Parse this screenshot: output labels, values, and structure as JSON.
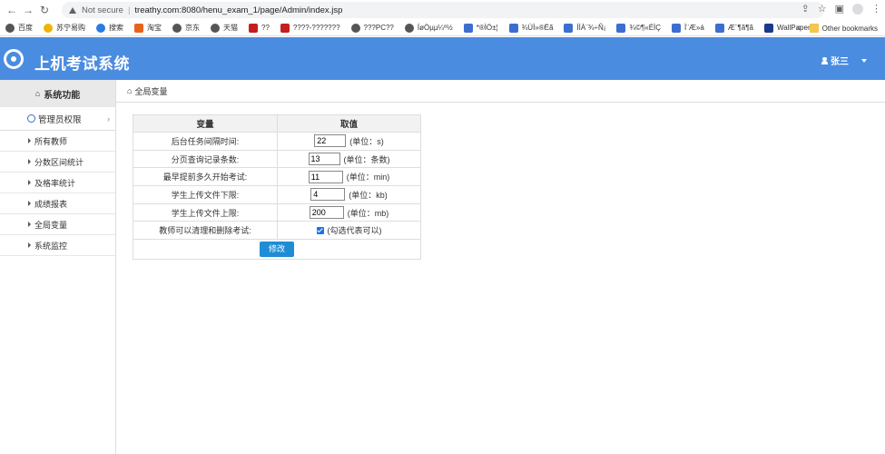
{
  "browser": {
    "security_label": "Not secure",
    "url": "treathy.com:8080/henu_exam_1/page/Admin/index.jsp",
    "bookmarks": [
      {
        "label": "百度",
        "icon": "globe-icon"
      },
      {
        "label": "苏宁易购",
        "icon": "suning-icon"
      },
      {
        "label": "搜索",
        "icon": "search-icon"
      },
      {
        "label": "淘宝",
        "icon": "taobao-icon"
      },
      {
        "label": "京东",
        "icon": "globe-icon"
      },
      {
        "label": "天猫",
        "icon": "globe-icon"
      },
      {
        "label": "??",
        "icon": "jd-icon"
      },
      {
        "label": "????-???????",
        "icon": "t-icon"
      },
      {
        "label": "???PC??",
        "icon": "globe-icon"
      },
      {
        "label": "ÍøÒµµ¼º½",
        "icon": "globe-icon"
      },
      {
        "label": "*®ÌÓ±¦",
        "icon": "paw-icon"
      },
      {
        "label": "¾ÙÌ»®Ëã",
        "icon": "paw-icon"
      },
      {
        "label": "ÌÌÀ¨¾÷Ñ¡",
        "icon": "paw-icon"
      },
      {
        "label": "¾©¶«ÉÌÇ",
        "icon": "paw-icon"
      },
      {
        "label": "Ì¨Æ»á",
        "icon": "paw-icon"
      },
      {
        "label": "Æ¨¶ã¶ã",
        "icon": "paw-icon"
      },
      {
        "label": "WallPaper",
        "icon": "wallpaper-icon"
      }
    ],
    "more_label": "»",
    "other_bookmarks": "Other bookmarks"
  },
  "app": {
    "title": "上机考试系统",
    "user_name": "张三"
  },
  "sidebar": {
    "header": "系统功能",
    "group_label": "管理员权限",
    "items": [
      "所有教师",
      "分数区间统计",
      "及格率统计",
      "成绩报表",
      "全局变量",
      "系统监控"
    ]
  },
  "breadcrumb": "全局变量",
  "table": {
    "headers": [
      "变量",
      "取值"
    ],
    "rows": [
      {
        "label": "后台任务间隔时间:",
        "value": "22",
        "unit": "(单位：s)"
      },
      {
        "label": "分页查询记录条数:",
        "value": "13",
        "unit": "(单位：条数)"
      },
      {
        "label": "最早提前多久开始考试:",
        "value": "11",
        "unit": "(单位：min)"
      },
      {
        "label": "学生上传文件下限:",
        "value": "4",
        "unit": "(单位：kb)"
      },
      {
        "label": "学生上传文件上限:",
        "value": "200",
        "unit": "(单位：mb)"
      }
    ],
    "checkbox_row": {
      "label": "教师可以清理和删除考试:",
      "note": "(勾选代表可以)",
      "checked": true
    },
    "submit_label": "修改"
  },
  "colors": {
    "header_bg": "#4a8ce0",
    "button_bg": "#1f8dd6",
    "sidebar_head_bg": "#e9e9e9"
  }
}
